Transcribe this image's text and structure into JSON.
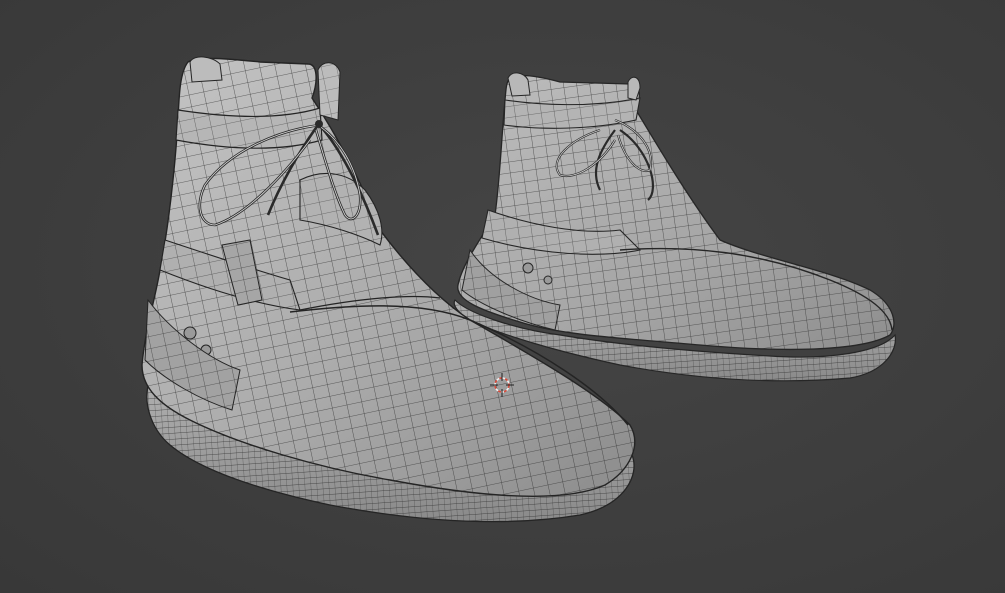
{
  "viewport": {
    "background": "#3d3d3d",
    "mesh_fill": "#a4a4a4",
    "mesh_fill_light": "#c2c2c2",
    "wire_color": "#2a2a2a",
    "cursor_primary": "#d94a3a",
    "cursor_secondary": "#f0f0f0"
  },
  "objects": [
    {
      "name": "left-shoe",
      "type": "mesh",
      "display": "wireframe-overlay"
    },
    {
      "name": "right-shoe",
      "type": "mesh",
      "display": "wireframe-overlay"
    }
  ],
  "cursor_icon": "3d-cursor-icon"
}
